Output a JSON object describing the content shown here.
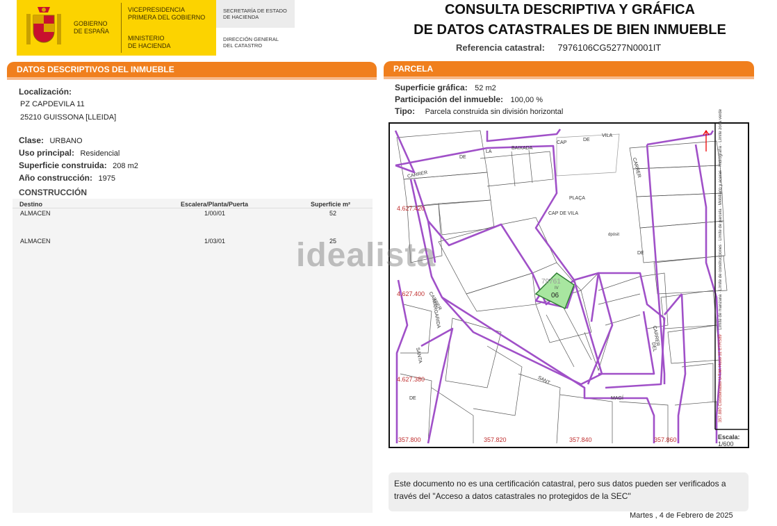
{
  "header": {
    "gov_name": [
      "GOBIERNO",
      "DE ESPAÑA"
    ],
    "vice": [
      "VICEPRESIDENCIA",
      "PRIMERA DEL GOBIERNO"
    ],
    "ministry": [
      "MINISTERIO",
      "DE HACIENDA"
    ],
    "secretaria": [
      "SECRETARÍA DE ESTADO",
      "DE HACIENDA"
    ],
    "direccion": [
      "DIRECCIÓN GENERAL",
      "DEL CATASTRO"
    ],
    "title_line1": "CONSULTA DESCRIPTIVA Y GRÁFICA",
    "title_line2": "DE DATOS CATASTRALES DE BIEN INMUEBLE",
    "ref_label": "Referencia catastral:",
    "ref_value": "7976106CG5277N0001IT"
  },
  "left": {
    "section_title": "DATOS DESCRIPTIVOS DEL INMUEBLE",
    "localizacion_label": "Localización:",
    "address_line1": "PZ CAPDEVILA 11",
    "address_line2": "25210 GUISSONA [LLEIDA]",
    "clase_label": "Clase:",
    "clase_value": "URBANO",
    "uso_label": "Uso principal:",
    "uso_value": "Residencial",
    "superficie_label": "Superficie construida:",
    "superficie_value": "208 m2",
    "anio_label": "Año construcción:",
    "anio_value": "1975",
    "construccion_title": "CONSTRUCCIÓN",
    "table_headers": [
      "Destino",
      "Escalera/Planta/Puerta",
      "Superficie m²"
    ],
    "table_rows": [
      {
        "destino": "ALMACEN",
        "planta": "1/00/01",
        "superficie": "52"
      },
      {
        "destino": "ALMACEN",
        "planta": "1/03/01",
        "superficie": "25"
      }
    ]
  },
  "right": {
    "section_title": "PARCELA",
    "sup_grafica_label": "Superficie gráfica:",
    "sup_grafica_value": "52 m2",
    "participacion_label": "Participación del inmueble:",
    "participacion_value": "100,00 %",
    "tipo_label": "Tipo:",
    "tipo_value": "Parcela construida sin división horizontal"
  },
  "map": {
    "coords_y": [
      "4.627.420",
      "4.627.400",
      "4.627.380"
    ],
    "coords_x": [
      "357.800",
      "357.820",
      "357.840",
      "357.860"
    ],
    "streets": [
      "CARRER",
      "DE",
      "LA",
      "BAIXADA",
      "CAP",
      "DE",
      "VILA",
      "CARRER",
      "PLAÇA",
      "CAP DE VILA",
      "dpósit",
      "DE",
      "CARRER",
      "MARGARIDA",
      "SANTA",
      "DE",
      "SANT",
      "MAGÍ",
      "CARRER",
      "DEL"
    ],
    "parcel_ref": "79761",
    "parcel_num": "06",
    "parcel_sub": "IV",
    "lot_numbers": [
      "1",
      "3",
      "7",
      "9",
      "3",
      "6",
      "8",
      "10",
      "12",
      "2",
      "1",
      "10",
      "36",
      "40",
      "34",
      "36",
      "32",
      "30",
      "28",
      "26",
      "24",
      "22",
      "20",
      "18",
      "16",
      "16",
      "14",
      "12",
      "10",
      "8",
      "6",
      "4",
      "16",
      "17",
      "18",
      "19",
      "11",
      "8",
      "9",
      "10",
      "11",
      "05",
      "12",
      "13",
      "21",
      "19",
      "20",
      "07",
      "12",
      "13",
      "14",
      "15",
      "17",
      "17",
      "16",
      "15",
      "13",
      "19",
      "19",
      "1",
      "3",
      "5",
      "7",
      "9",
      "2",
      "4",
      "6",
      "10",
      "8",
      "4",
      "2",
      "1",
      "3",
      "5"
    ],
    "legend": [
      "Límite de parcela",
      "Límite zona verde",
      "Hidrografía",
      "Mobiliario y aceras",
      "Límite de manzana",
      "Límite de construcciones",
      "357.880 Coordenadas U.T.M. Huso 31 ETRS89"
    ],
    "scale_label": "Escala:",
    "scale_value": "1/600"
  },
  "footer": {
    "note": "Este documento no es una certificación catastral, pero sus datos pueden ser verificados a través del \"Acceso a datos catastrales no protegidos de la SEC\"",
    "date": "Martes , 4 de Febrero de 2025"
  },
  "watermark": "idealista",
  "colors": {
    "orange": "#f07f1d",
    "yellow": "#fcd300",
    "parcel_line": "#a050c8",
    "highlight": "#a8e6a0"
  }
}
